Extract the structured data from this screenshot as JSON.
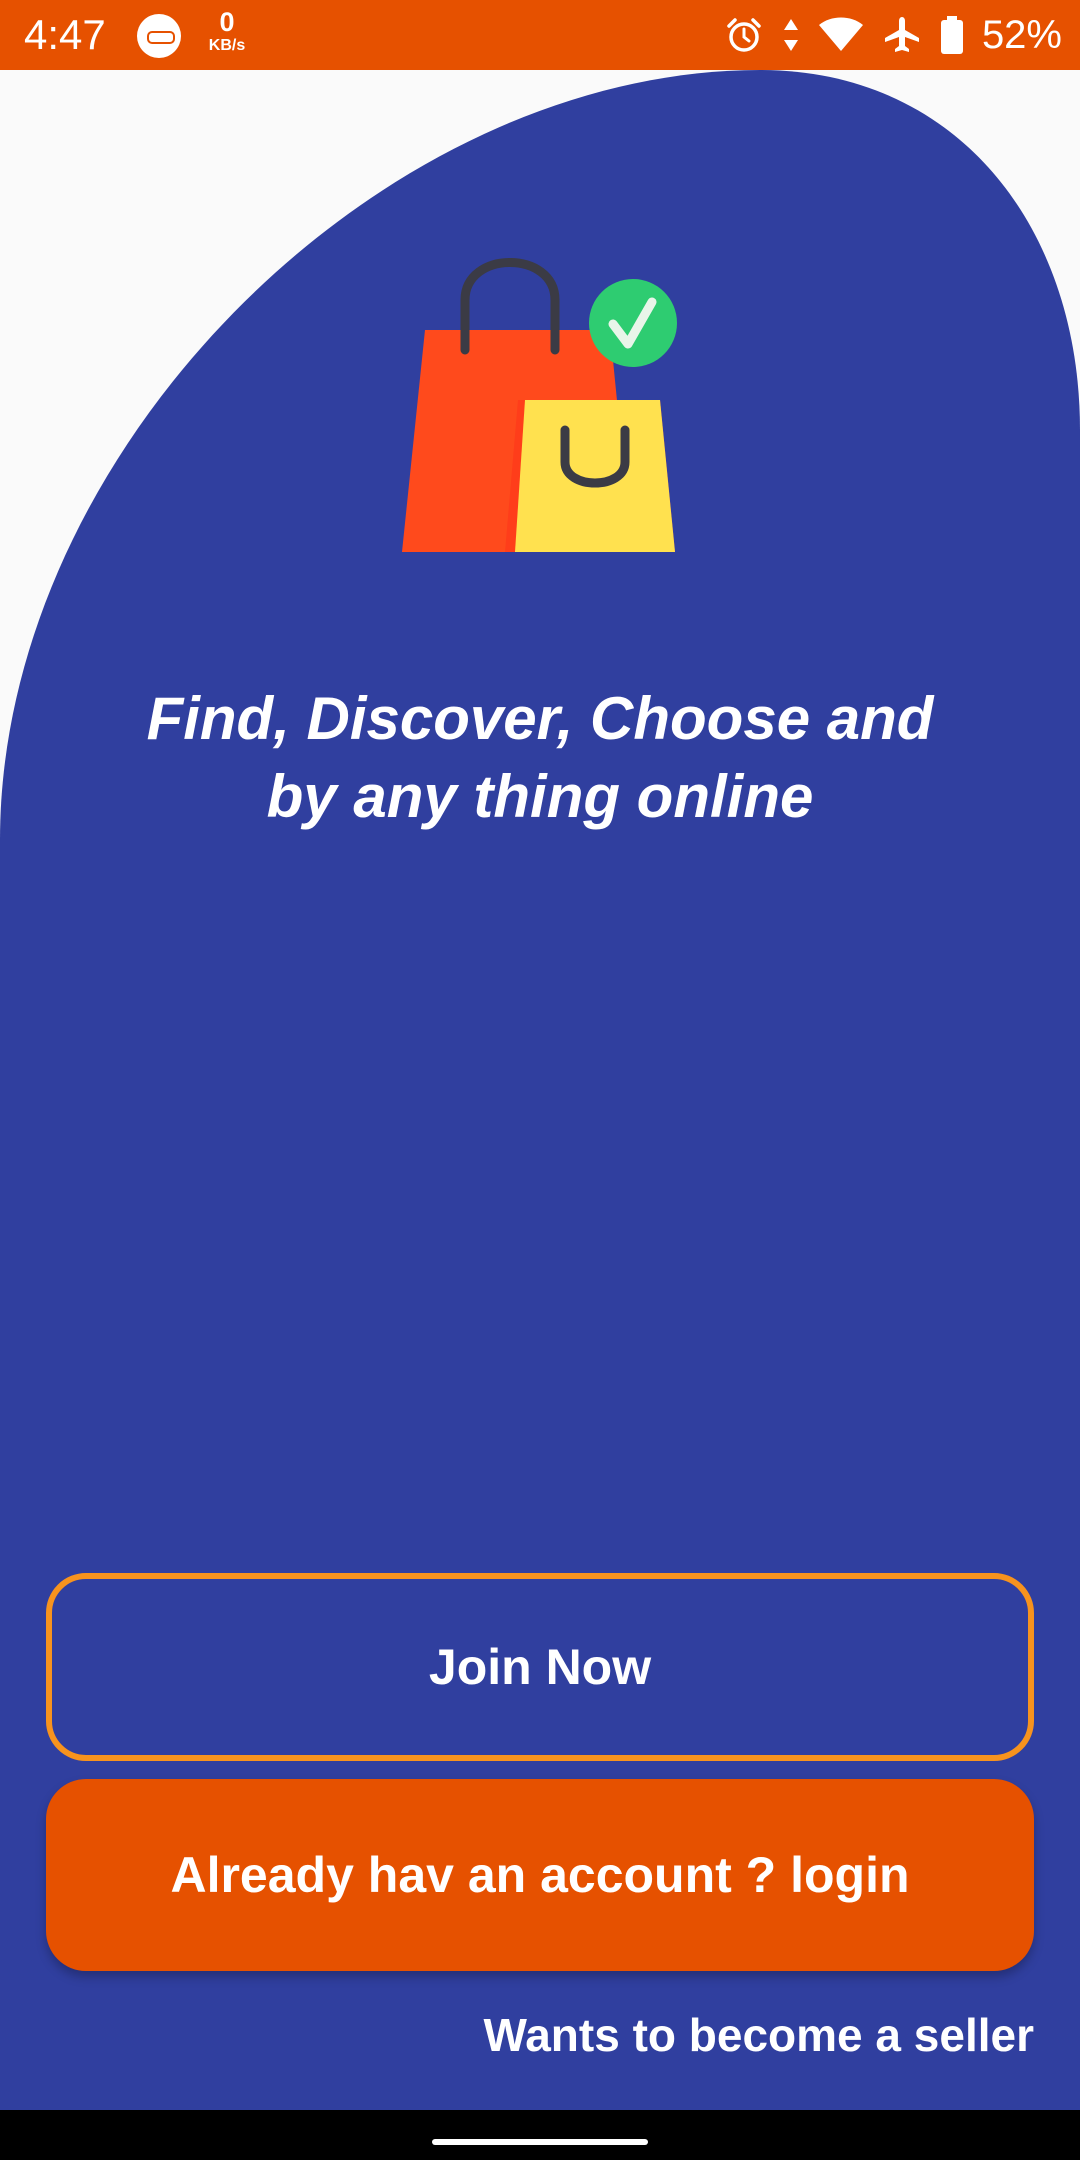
{
  "status_bar": {
    "time": "4:47",
    "net_speed_value": "0",
    "net_speed_unit": "KB/s",
    "battery_percent": "52%",
    "icons": [
      "notification-app-icon",
      "alarm-icon",
      "data-arrows-icon",
      "wifi-icon",
      "airplane-mode-icon",
      "battery-icon"
    ],
    "background_color": "#e65100"
  },
  "hero": {
    "illustration": "shopping-bags-with-checkmark",
    "tagline_line1": "Find, Discover, Choose and",
    "tagline_line2": "by any thing online"
  },
  "actions": {
    "join_label": "Join Now",
    "login_label": "Already hav an account ? login",
    "seller_label": "Wants to become a seller"
  },
  "colors": {
    "primary_blue": "#303f9f",
    "accent_orange": "#e65100",
    "outline_orange": "#f7931e",
    "background": "#fafafa"
  }
}
